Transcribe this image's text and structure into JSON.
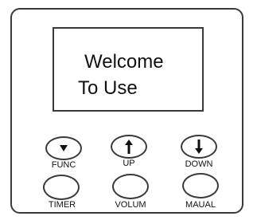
{
  "display": {
    "line1": "Welcome",
    "line2": "To Use"
  },
  "buttons": {
    "func": {
      "label": "FUNC",
      "icon": "triangle-down-icon"
    },
    "up": {
      "label": "UP",
      "icon": "arrow-up-icon"
    },
    "down": {
      "label": "DOWN",
      "icon": "arrow-down-icon"
    },
    "timer": {
      "label": "TIMER"
    },
    "volum": {
      "label": "VOLUM"
    },
    "maual": {
      "label": "MAUAL"
    }
  },
  "colors": {
    "outline": "#3a3a3a",
    "text": "#111111",
    "background": "#ffffff"
  }
}
